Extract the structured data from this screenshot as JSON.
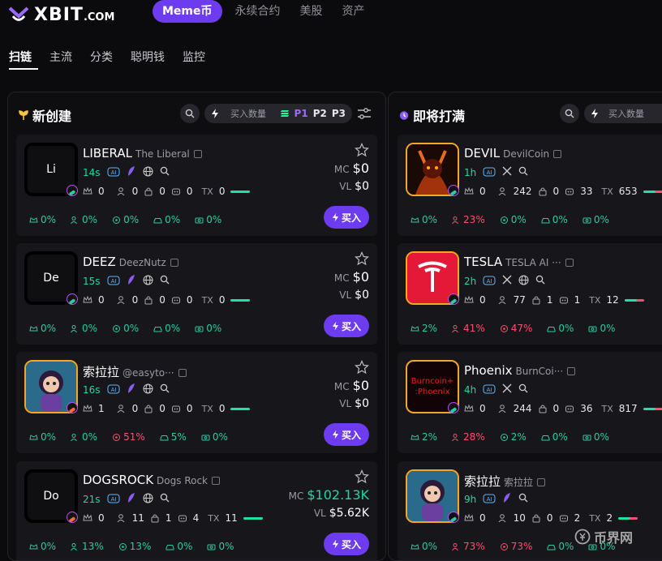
{
  "header": {
    "logo": "XBIT",
    "logo_suffix": ".COM",
    "nav": [
      "Meme币",
      "永续合约",
      "美股",
      "资产"
    ]
  },
  "subtabs": [
    "扫链",
    "主流",
    "分类",
    "聪明钱",
    "监控"
  ],
  "panels": {
    "new": {
      "title": "新创建",
      "buy_placeholder": "买入数量",
      "presets": [
        "P1",
        "P2",
        "P3"
      ]
    },
    "soon": {
      "title": "即将打满",
      "buy_placeholder": "买入数量"
    }
  },
  "labels": {
    "mc": "MC",
    "vl": "VL",
    "tx": "TX",
    "buy": "买入",
    "ai": "AI"
  },
  "new_tokens": [
    {
      "initials": "Li",
      "symbol": "LIBERAL",
      "name": "The Liberal",
      "age": "14s",
      "holders": "0",
      "h2": "0",
      "h3": "0",
      "h4": "0",
      "tx": "0",
      "mc": "$0",
      "vl": "$0",
      "s1": "0%",
      "s2": "0%",
      "s3": "0%",
      "s4": "0%",
      "s5": "0%"
    },
    {
      "initials": "De",
      "symbol": "DEEZ",
      "name": "DeezNutz",
      "age": "15s",
      "holders": "0",
      "h2": "0",
      "h3": "0",
      "h4": "0",
      "tx": "0",
      "mc": "$0",
      "vl": "$0",
      "s1": "0%",
      "s2": "0%",
      "s3": "0%",
      "s4": "0%",
      "s5": "0%"
    },
    {
      "initials": "",
      "symbol": "索拉拉",
      "name": "@easyto···",
      "age": "16s",
      "holders": "1",
      "h2": "0",
      "h3": "0",
      "h4": "0",
      "tx": "0",
      "mc": "$0",
      "vl": "$0",
      "s1": "0%",
      "s2": "0%",
      "s3": "51%",
      "s4": "5%",
      "s5": "0%"
    },
    {
      "initials": "Do",
      "symbol": "DOGSROCK",
      "name": "Dogs Rock",
      "age": "21s",
      "holders": "0",
      "h2": "11",
      "h3": "1",
      "h4": "4",
      "tx": "11",
      "mc": "$102.13K",
      "vl": "$5.62K",
      "s1": "0%",
      "s2": "13%",
      "s3": "13%",
      "s4": "0%",
      "s5": "0%"
    }
  ],
  "soon_tokens": [
    {
      "symbol": "DEVIL",
      "name": "DevilCoin",
      "age": "1h",
      "holders": "0",
      "h2": "242",
      "h3": "0",
      "h4": "33",
      "tx": "653",
      "s1": "0%",
      "s2": "23%",
      "s3": "0%",
      "s4": "0%",
      "s5": "0%"
    },
    {
      "symbol": "TESLA",
      "name": "TESLA AI ···",
      "age": "2h",
      "holders": "0",
      "h2": "77",
      "h3": "1",
      "h4": "1",
      "tx": "12",
      "s1": "2%",
      "s2": "41%",
      "s3": "47%",
      "s4": "0%",
      "s5": "0%"
    },
    {
      "symbol": "Phoenix",
      "name": "BurnCoi···",
      "age": "4h",
      "holders": "0",
      "h2": "244",
      "h3": "0",
      "h4": "36",
      "tx": "817",
      "s1": "2%",
      "s2": "28%",
      "s3": "2%",
      "s4": "0%",
      "s5": "0%",
      "thumb_text": "Burncoin+ :Phoenix"
    },
    {
      "symbol": "索拉拉",
      "name": "索拉拉",
      "age": "9h",
      "holders": "0",
      "h2": "10",
      "h3": "0",
      "h4": "2",
      "tx": "2",
      "s1": "0%",
      "s2": "73%",
      "s3": "73%",
      "s4": "0%",
      "s5": "0%"
    }
  ],
  "watermark": "币界网",
  "colors": {
    "accent": "#6d3cf0",
    "green": "#20d6a4",
    "red": "#ff4d6d",
    "gold": "#f5a623"
  }
}
